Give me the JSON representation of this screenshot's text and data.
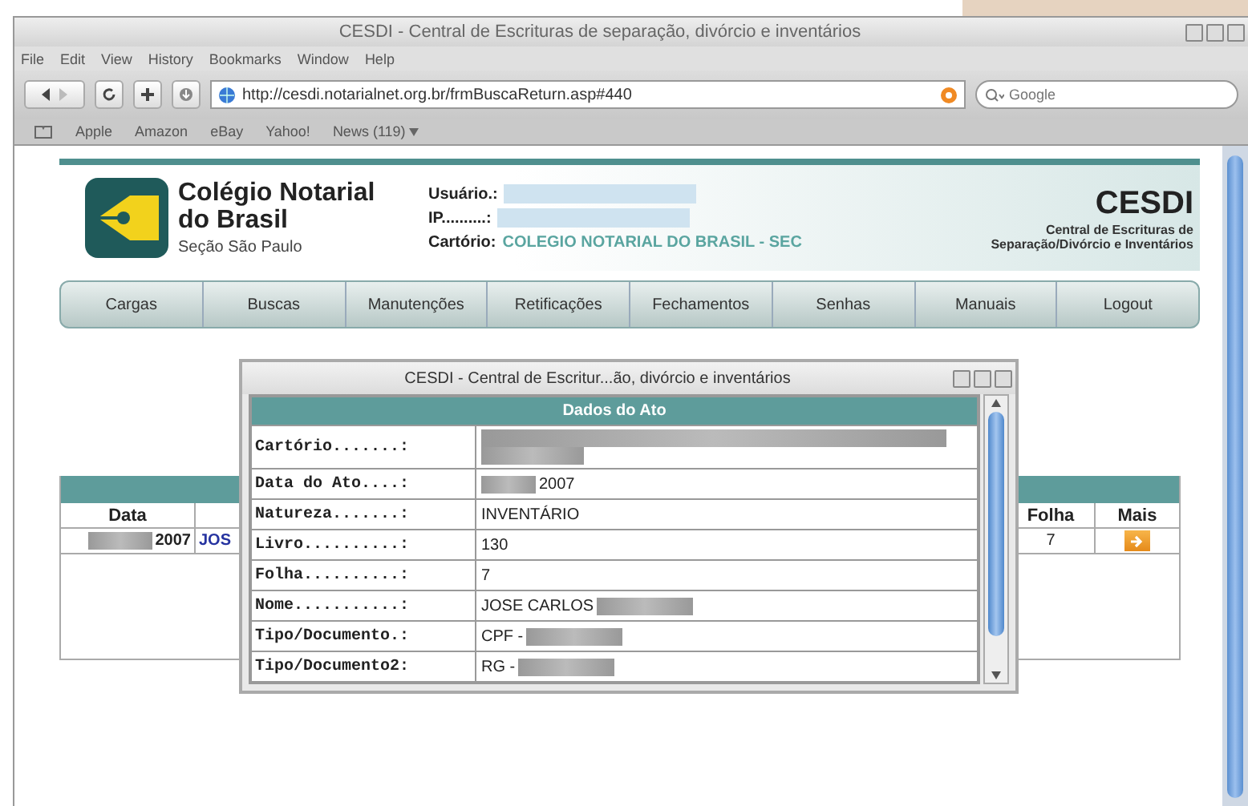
{
  "window": {
    "title": "CESDI - Central de Escrituras de separação, divórcio e inventários"
  },
  "menu": [
    "File",
    "Edit",
    "View",
    "History",
    "Bookmarks",
    "Window",
    "Help"
  ],
  "toolbar": {
    "url": "http://cesdi.notarialnet.org.br/frmBuscaReturn.asp#440",
    "search": {
      "placeholder": "Google"
    }
  },
  "bookmarks": [
    "Apple",
    "Amazon",
    "eBay",
    "Yahoo!",
    "News (119)"
  ],
  "header": {
    "org_lines": [
      "Colégio Notarial",
      "do Brasil"
    ],
    "org_sub": "Seção São Paulo",
    "fields": [
      {
        "label": "Usuário.:",
        "redacted": true
      },
      {
        "label": "IP..........:",
        "redacted": true
      },
      {
        "label": "Cartório:",
        "value": "COLEGIO NOTARIAL DO BRASIL - SEC",
        "redacted": false
      }
    ],
    "brand": "CESDI",
    "brand_sub": [
      "Central de Escrituras de",
      "Separação/Divórcio e Inventários"
    ]
  },
  "nav": [
    "Cargas",
    "Buscas",
    "Manutenções",
    "Retificações",
    "Fechamentos",
    "Senhas",
    "Manuais",
    "Logout"
  ],
  "table": {
    "columns": [
      "Data",
      "",
      "Folha",
      "Mais"
    ],
    "rows": [
      {
        "data": "2007",
        "column_2": "JOS",
        "folha": "7"
      }
    ]
  },
  "popup": {
    "title": "CESDI - Central de Escritur...ão, divórcio e inventários",
    "heading": "Dados do Ato",
    "rows": [
      {
        "label": "Cartório.......:",
        "masked_before": true,
        "masked_after": false
      },
      {
        "label": "Data do Ato....:",
        "value": "2007",
        "masked_before": true,
        "masked_after": false
      },
      {
        "label": "Natureza.......:",
        "value": "INVENTÁRIO",
        "masked_before": false,
        "masked_after": false
      },
      {
        "label": "Livro..........:",
        "value": "130",
        "masked_before": false,
        "masked_after": false
      },
      {
        "label": "Folha..........:",
        "value": "7",
        "masked_before": false,
        "masked_after": false
      },
      {
        "label": "Nome...........:",
        "value": "JOSE CARLOS",
        "masked_before": false,
        "masked_after": true
      },
      {
        "label": "Tipo/Documento.:",
        "value": "CPF -",
        "masked_before": false,
        "masked_after": true
      },
      {
        "label": "Tipo/Documento2:",
        "value": "RG -",
        "masked_before": false,
        "masked_after": true
      }
    ]
  }
}
